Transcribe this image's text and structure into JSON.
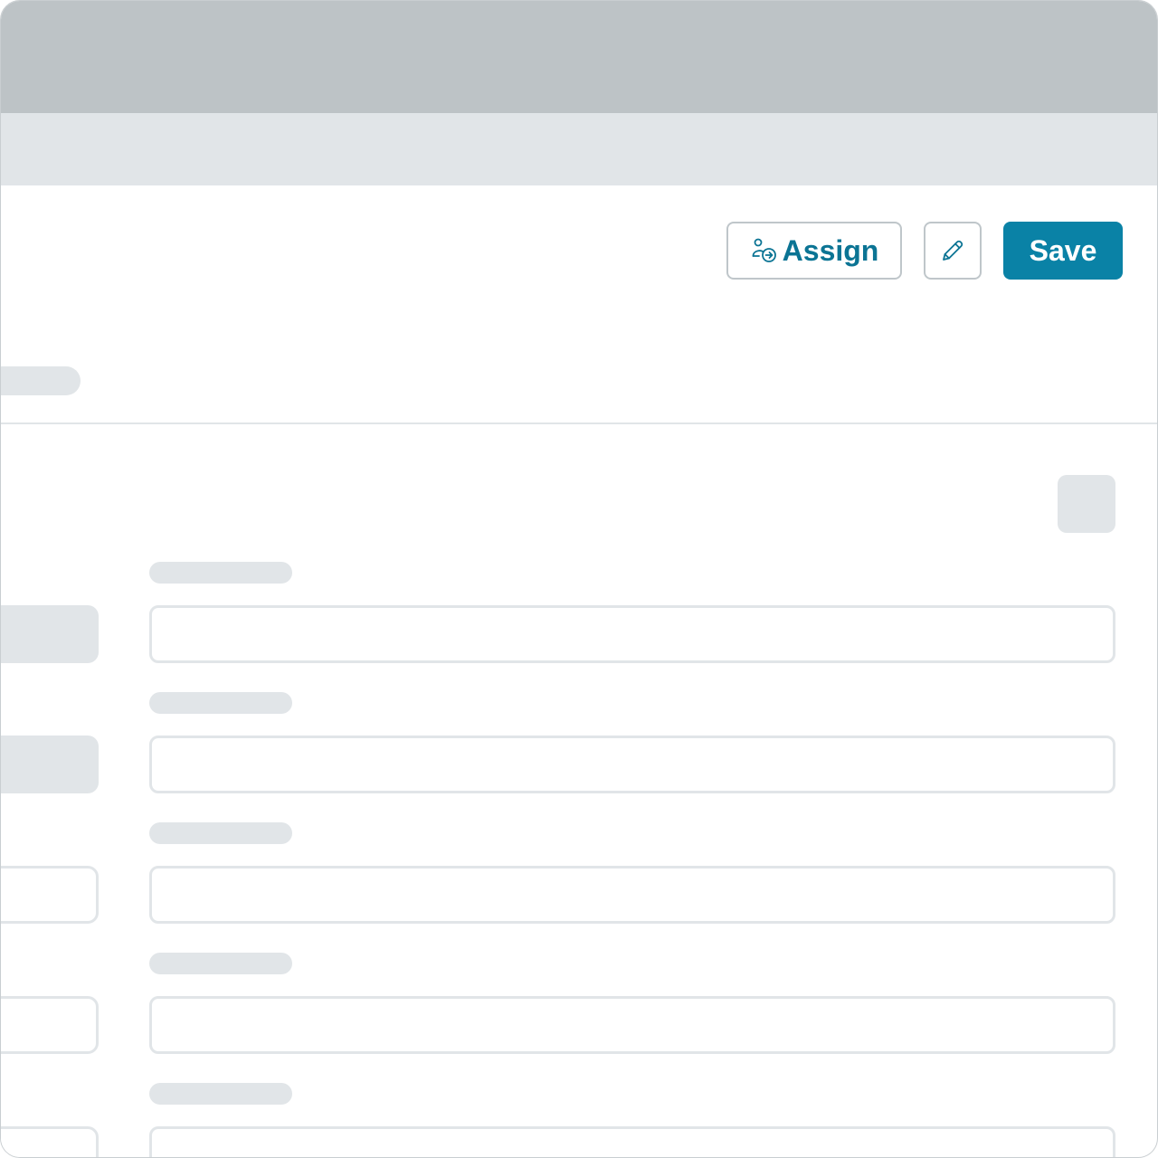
{
  "toolbar": {
    "assign_label": "Assign",
    "assign_icon": "user-assign-icon",
    "edit_icon": "pencil-icon",
    "save_label": "Save"
  },
  "colors": {
    "accent": "#0a82a6",
    "accent_text": "#0b7494",
    "top_bar": "#bdc3c6",
    "sub_bar": "#e1e5e8",
    "skeleton": "#e1e5e8"
  },
  "form": {
    "field_count": 5
  }
}
